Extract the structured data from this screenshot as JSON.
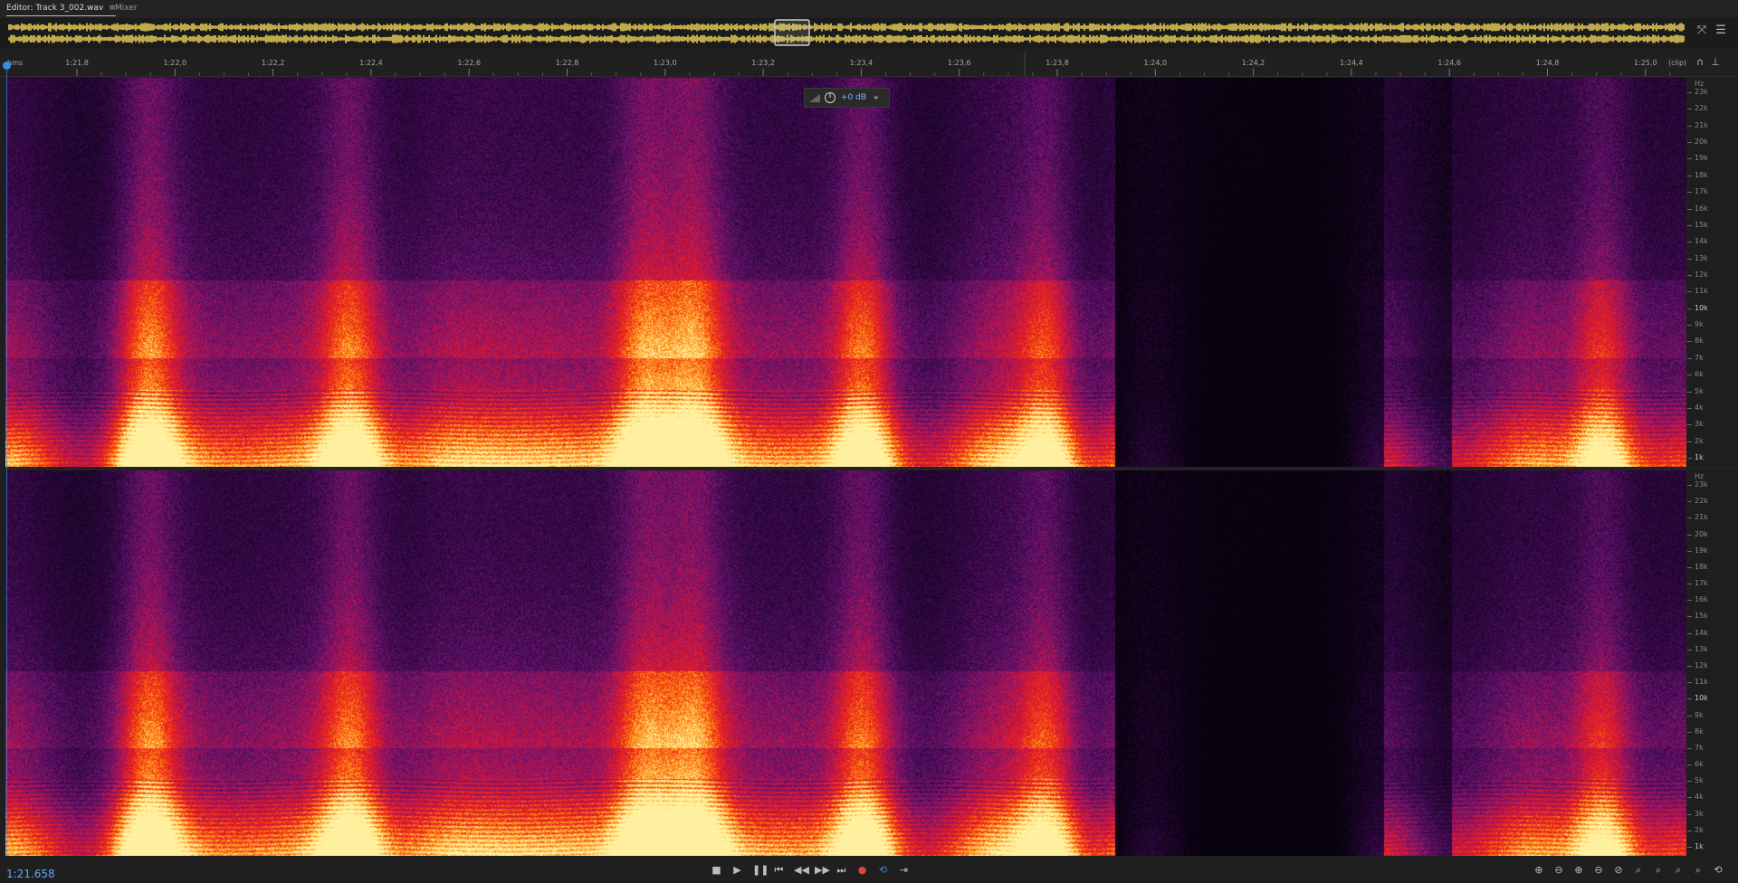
{
  "tabs": {
    "editor_label": "Editor: Track 3_002.wav",
    "editor_menu": "≡",
    "mixer_label": "Mixer"
  },
  "ruler": {
    "unit": "hms",
    "ticks": [
      "1:21,8",
      "1:22,0",
      "1:22,2",
      "1:22,4",
      "1:22,6",
      "1:22,8",
      "1:23,0",
      "1:23,2",
      "1:23,4",
      "1:23,6",
      "1:23,8",
      "1:24,0",
      "1:24,2",
      "1:24,4",
      "1:24,6",
      "1:24,8",
      "1:25,0"
    ],
    "clip_label": "(clip)"
  },
  "hud": {
    "gain": "+0 dB"
  },
  "frequency_axis": {
    "unit": "Hz",
    "labels": [
      "23k",
      "22k",
      "21k",
      "20k",
      "19k",
      "18k",
      "17k",
      "16k",
      "15k",
      "14k",
      "13k",
      "12k",
      "11k",
      "10k",
      "9k",
      "8k",
      "7k",
      "6k",
      "5k",
      "4k",
      "3k",
      "2k",
      "1k"
    ]
  },
  "status": {
    "current_time": "1:21.658"
  },
  "icons": {
    "overview_zoom": "zoom-to-selection-icon",
    "overview_menu": "panel-menu-icon",
    "snap": "snap-magnet-icon",
    "pin": "pin-icon"
  },
  "colors": {
    "accent": "#3a8ee6",
    "timecode": "#5fa8ff",
    "record": "#e0443a",
    "waveform": "#e8cf5a"
  }
}
